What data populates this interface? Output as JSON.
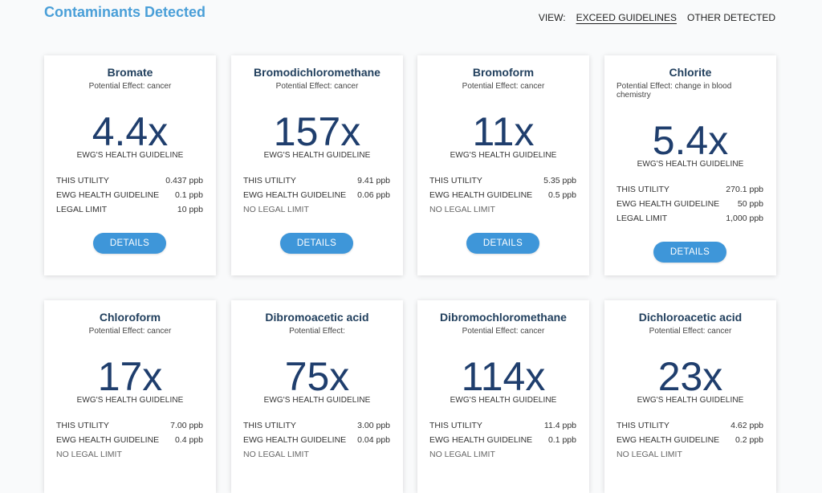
{
  "page": {
    "title": "Contaminants Detected"
  },
  "view": {
    "label": "VIEW:",
    "options": [
      "EXCEED GUIDELINES",
      "OTHER DETECTED"
    ]
  },
  "labels": {
    "guideline": "EWG'S HEALTH GUIDELINE",
    "this_utility": "THIS UTILITY",
    "ewg_health_guideline": "EWG HEALTH GUIDELINE",
    "legal_limit": "LEGAL LIMIT",
    "no_legal_limit": "NO LEGAL LIMIT",
    "details": "DETAILS"
  },
  "cards": [
    {
      "name": "Bromate",
      "effect": "Potential Effect: cancer",
      "multiplier": "4.4x",
      "this_utility": "0.437 ppb",
      "ewg_guideline": "0.1 ppb",
      "legal_limit": "10 ppb"
    },
    {
      "name": "Bromodichloromethane",
      "effect": "Potential Effect: cancer",
      "multiplier": "157x",
      "this_utility": "9.41 ppb",
      "ewg_guideline": "0.06 ppb",
      "legal_limit": ""
    },
    {
      "name": "Bromoform",
      "effect": "Potential Effect: cancer",
      "multiplier": "11x",
      "this_utility": "5.35 ppb",
      "ewg_guideline": "0.5 ppb",
      "legal_limit": ""
    },
    {
      "name": "Chlorite",
      "effect": "Potential Effect: change in blood chemistry",
      "multiplier": "5.4x",
      "this_utility": "270.1 ppb",
      "ewg_guideline": "50 ppb",
      "legal_limit": "1,000 ppb"
    },
    {
      "name": "Chloroform",
      "effect": "Potential Effect: cancer",
      "multiplier": "17x",
      "this_utility": "7.00 ppb",
      "ewg_guideline": "0.4 ppb",
      "legal_limit": ""
    },
    {
      "name": "Dibromoacetic acid",
      "effect": "Potential Effect:",
      "multiplier": "75x",
      "this_utility": "3.00 ppb",
      "ewg_guideline": "0.04 ppb",
      "legal_limit": ""
    },
    {
      "name": "Dibromochloromethane",
      "effect": "Potential Effect: cancer",
      "multiplier": "114x",
      "this_utility": "11.4 ppb",
      "ewg_guideline": "0.1 ppb",
      "legal_limit": ""
    },
    {
      "name": "Dichloroacetic acid",
      "effect": "Potential Effect: cancer",
      "multiplier": "23x",
      "this_utility": "4.62 ppb",
      "ewg_guideline": "0.2 ppb",
      "legal_limit": ""
    }
  ]
}
